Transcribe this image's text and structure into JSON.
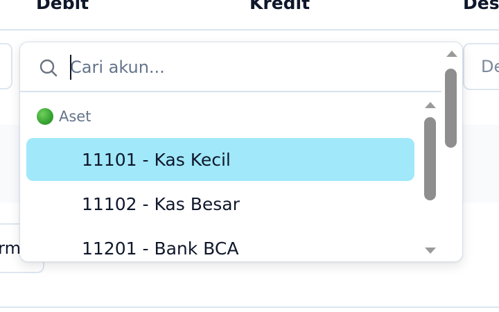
{
  "table_header": {
    "debit": "Debit",
    "kredit": "Kredit",
    "deskripsi": "Des"
  },
  "description_input": {
    "text": "De"
  },
  "left_button": {
    "text": "rm"
  },
  "account_dropdown": {
    "search": {
      "placeholder": "Cari akun...",
      "value": ""
    },
    "groups": [
      {
        "label": "Aset",
        "icon": "green-circle-icon",
        "icon_color": "#3aa935",
        "options": [
          {
            "label": "11101 - Kas Kecil",
            "selected": true
          },
          {
            "label": "11102 - Kas Besar",
            "selected": false
          },
          {
            "label": "11201 - Bank BCA",
            "selected": false
          }
        ]
      }
    ]
  },
  "colors": {
    "selected_option_bg": "#a0e8fa",
    "border": "#d6dee8",
    "muted_text": "#64748b"
  }
}
